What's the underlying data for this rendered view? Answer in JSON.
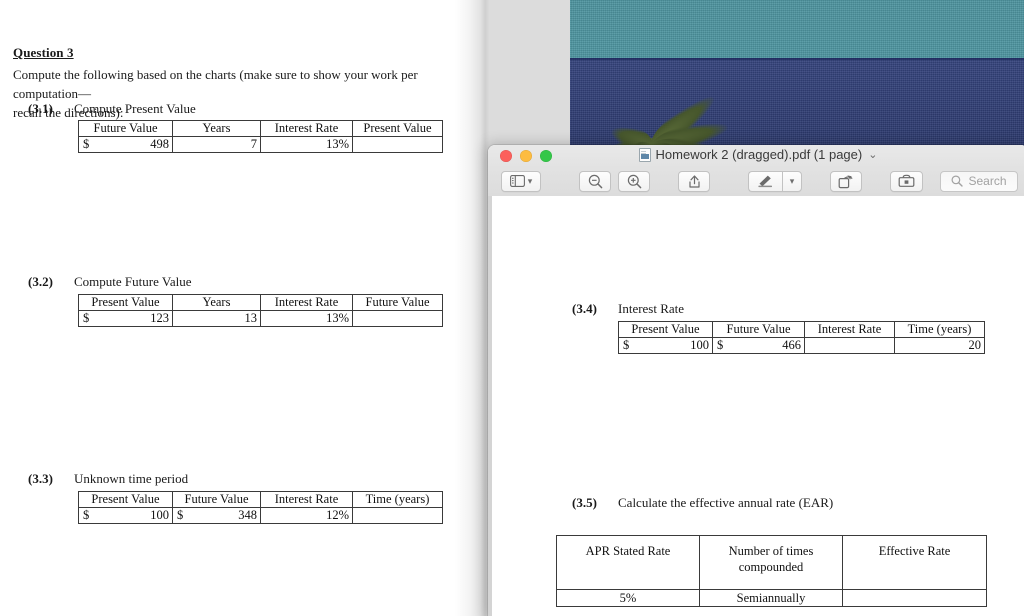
{
  "desktop": {
    "wallpaper_sky_color": "#4f95a0",
    "wallpaper_sea_color": "#2d3a6e"
  },
  "background_document": {
    "question_heading": "Question 3",
    "intro_line1": "Compute the following based on the charts (make sure to show your work per computation—",
    "intro_line2": "recall the directions):",
    "sections": [
      {
        "number": "(3.1)",
        "label": "Compute Present Value",
        "headers": [
          "Future Value",
          "Years",
          "Interest Rate",
          "Present Value"
        ],
        "row": [
          {
            "symbol": "$",
            "value": "498"
          },
          {
            "symbol": "",
            "value": "7"
          },
          {
            "symbol": "",
            "value": "13%"
          },
          {
            "symbol": "",
            "value": ""
          }
        ]
      },
      {
        "number": "(3.2)",
        "label": "Compute Future Value",
        "headers": [
          "Present Value",
          "Years",
          "Interest Rate",
          "Future Value"
        ],
        "row": [
          {
            "symbol": "$",
            "value": "123"
          },
          {
            "symbol": "",
            "value": "13"
          },
          {
            "symbol": "",
            "value": "13%"
          },
          {
            "symbol": "",
            "value": ""
          }
        ]
      },
      {
        "number": "(3.3)",
        "label": "Unknown time period",
        "headers": [
          "Present Value",
          "Future Value",
          "Interest Rate",
          "Time (years)"
        ],
        "row": [
          {
            "symbol": "$",
            "value": "100"
          },
          {
            "symbol": "$",
            "value": "348"
          },
          {
            "symbol": "",
            "value": "12%"
          },
          {
            "symbol": "",
            "value": ""
          }
        ]
      }
    ]
  },
  "preview_window": {
    "title": "Homework 2 (dragged).pdf (1 page)",
    "title_chevron": "⌄",
    "traffic_lights": {
      "close": "close-button",
      "minimize": "minimize-button",
      "zoom": "zoom-button"
    },
    "toolbar": {
      "sidebar_label": "Sidebar view",
      "zoom_out_label": "Zoom Out",
      "zoom_in_label": "Zoom In",
      "share_label": "Share",
      "markup_label": "Markup",
      "markup_menu_label": "Markup options",
      "rotate_label": "Rotate",
      "toolbox_label": "Show Markup Toolbar"
    },
    "search": {
      "placeholder": "Search",
      "value": ""
    },
    "document": {
      "sections": [
        {
          "number": "(3.4)",
          "label": "Interest Rate",
          "headers": [
            "Present Value",
            "Future Value",
            "Interest Rate",
            "Time (years)"
          ],
          "row": [
            {
              "symbol": "$",
              "value": "100"
            },
            {
              "symbol": "$",
              "value": "466"
            },
            {
              "symbol": "",
              "value": ""
            },
            {
              "symbol": "",
              "value": "20"
            }
          ]
        }
      ],
      "ear_section": {
        "number": "(3.5)",
        "label": "Calculate the effective annual rate (EAR)",
        "headers": [
          "APR Stated Rate",
          "Number of times compounded",
          "Effective Rate"
        ],
        "header_line1": "Number of times",
        "header_line2": "compounded",
        "row": [
          "5%",
          "Semiannually",
          ""
        ]
      }
    }
  }
}
